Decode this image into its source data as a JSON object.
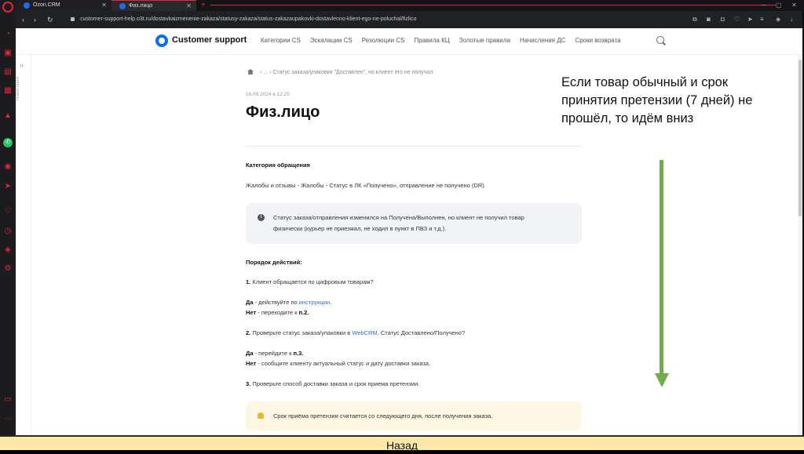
{
  "browser": {
    "tabs": [
      {
        "label": "Ozon.CRM",
        "icon": "ozon-icon"
      },
      {
        "label": "Физ.лицо",
        "icon": "ozon-icon"
      }
    ],
    "url": "customer-support-help.o3t.ru/dostavkaizmenenie-zakaza/statusy-zakaza/status-zakazaupakovki-dostavlenno-klient-ego-ne-poluchal/fizlico",
    "sidebar_icons": [
      "opera-logo",
      "shopping-bag-icon",
      "bag-icon",
      "twitch-icon",
      "calendar-icon",
      "fire-icon",
      "whatsapp-icon",
      "player-icon",
      "send-icon",
      "heart-icon",
      "clock-icon",
      "cube-icon",
      "settings-icon"
    ],
    "accent": "#e3263a"
  },
  "site": {
    "logo_text": "Customer support",
    "brand_color": "#0a6cf5",
    "menu": [
      "Категории CS",
      "Эскалации CS",
      "Резолюции CS",
      "Правила КЦ",
      "Золотые правила",
      "Начисления ДС",
      "Сроки возврата"
    ]
  },
  "sidebar_nav": {
    "label": "Навигация"
  },
  "article": {
    "breadcrumb": {
      "ellipsis": "...",
      "current": "Статус заказа/упаковки \"Доставлен\", но клиент его не получал"
    },
    "date": "16.09.2024 в 12:25",
    "title": "Физ.лицо",
    "category_heading": "Категория обращения",
    "category_text": "Жалобы и отзывы - Жалобы - Статус в ЛК «Получено», отправление не получено (DR).",
    "info_line1": "Статус заказа/отправления изменился на Получена/Выполнен, но клиент не получил товар",
    "info_line2": "физически (курьер не приезжал, не ходил в пункт в ПВЗ и т.д.).",
    "steps_heading": "Порядок действий:",
    "step1": {
      "num": "1.",
      "text": " Клиент обращается по цифровым товарам?"
    },
    "step1_yes": {
      "label": "Да",
      "text": " - действуйте по ",
      "link": "инструкции",
      "end": "."
    },
    "step1_no": {
      "label": "Нет",
      "text": " - переходите к ",
      "ref": "п.2."
    },
    "step2": {
      "num": "2.",
      "text": " Проверьте статус заказа/упаковки в ",
      "link": "WebCRM",
      "end": ". Статус Доставлено/Получено?"
    },
    "step2_yes": {
      "label": "Да",
      "text": " - перейдите к ",
      "ref": "п.3."
    },
    "step2_no": {
      "label": "Нет",
      "text": " - сообщите клиенту актуальный статус и дату доставки заказа."
    },
    "step3": {
      "num": "3.",
      "text": " Проверьте способ доставки заказа и срок приема претензии."
    },
    "warning": "Срок приёма претензии считается со следующего дня, после получения заказа."
  },
  "annotation": {
    "text": "Если товар обычный и срок принятия претензии (7 дней) не прошёл, то идём вниз",
    "arrow_color": "#70ad47"
  },
  "footer": {
    "back_label": "Назад",
    "bg": "#fce8a8"
  }
}
